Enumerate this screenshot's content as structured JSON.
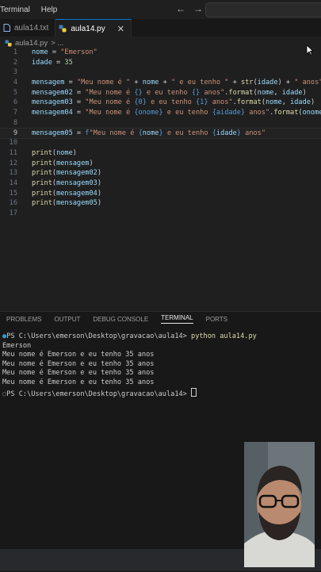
{
  "menu": [
    "Terminal",
    "Help"
  ],
  "nav": {
    "back": "←",
    "forward": "→"
  },
  "tabs": [
    {
      "label": "aula14.txt",
      "icon": "file-icon"
    },
    {
      "label": "aula14.py",
      "icon": "python-icon",
      "close": "✕"
    }
  ],
  "breadcrumb": {
    "file": "aula14.py",
    "more": "> ..."
  },
  "editor": {
    "line_numbers": [
      "1",
      "2",
      "3",
      "4",
      "5",
      "6",
      "7",
      "8",
      "9",
      "10",
      "11",
      "12",
      "13",
      "14",
      "15",
      "16",
      "17"
    ],
    "current_line": 9
  },
  "panel": {
    "tabs": [
      "PROBLEMS",
      "OUTPUT",
      "DEBUG CONSOLE",
      "TERMINAL",
      "PORTS"
    ],
    "active_tab": "TERMINAL"
  },
  "terminal": {
    "prompt1": "PS C:\\Users\\emerson\\Desktop\\gravacao\\aula14> ",
    "command": "python aula14.py",
    "output": [
      "Emerson",
      "Meu nome é Emerson e eu tenho 35 anos",
      "Meu nome é Emerson e eu tenho 35 anos",
      "Meu nome é Emerson e eu tenho 35 anos",
      "Meu nome é Emerson e eu tenho 35 anos"
    ],
    "prompt2": "PS C:\\Users\\emerson\\Desktop\\gravacao\\aula14> "
  },
  "colors": {
    "keyword_var": "#9cdcfe",
    "string": "#ce9178",
    "function": "#dcdcaa",
    "number": "#b5cea8",
    "fstring_prefix": "#569cd6"
  }
}
